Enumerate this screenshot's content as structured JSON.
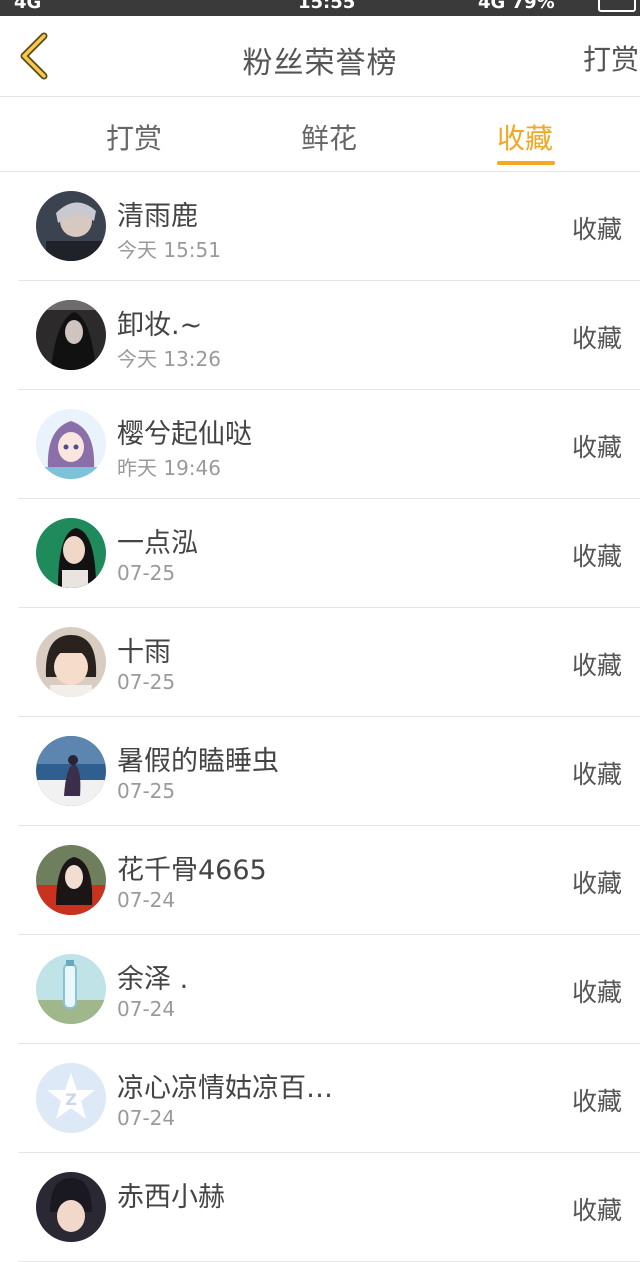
{
  "status_bar": {
    "left_text": "4G ",
    "time": "15:55",
    "right_text": "4G 79%"
  },
  "nav": {
    "title": "粉丝荣誉榜",
    "right_label": "打赏"
  },
  "tabs": [
    {
      "label": "打赏",
      "active": false
    },
    {
      "label": "鲜花",
      "active": false
    },
    {
      "label": "收藏",
      "active": true
    }
  ],
  "accent_color": "#f5a623",
  "fans": [
    {
      "name": "清雨鹿",
      "time": "今天 15:51",
      "action": "收藏"
    },
    {
      "name": "卸妆.~",
      "time": "今天 13:26",
      "action": "收藏"
    },
    {
      "name": "樱兮起仙哒",
      "time": "昨天 19:46",
      "action": "收藏"
    },
    {
      "name": "一点泓",
      "time": "07-25",
      "action": "收藏"
    },
    {
      "name": "十雨",
      "time": "07-25",
      "action": "收藏"
    },
    {
      "name": "暑假的瞌睡虫",
      "time": "07-25",
      "action": "收藏"
    },
    {
      "name": "花千骨4665",
      "time": "07-24",
      "action": "收藏"
    },
    {
      "name": "余泽 .",
      "time": "07-24",
      "action": "收藏"
    },
    {
      "name": "凉心凉情姑凉百…",
      "time": "07-24",
      "action": "收藏"
    },
    {
      "name": "赤西小赫",
      "time": "",
      "action": "收藏"
    }
  ]
}
